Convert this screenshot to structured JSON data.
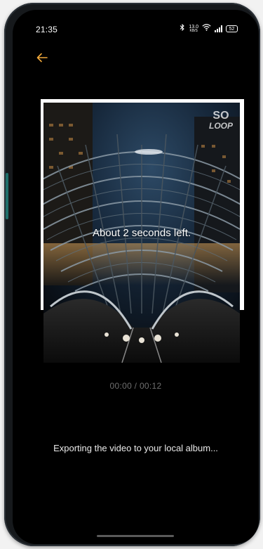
{
  "status_bar": {
    "time": "21:35",
    "bluetooth_icon": "bluetooth-icon",
    "network_speed_value": "13.0",
    "network_speed_unit": "KB/S",
    "wifi_icon": "wifi-icon",
    "signal_icon": "signal-icon",
    "battery_level": "52"
  },
  "toolbar": {
    "back_icon": "arrow-left-icon",
    "accent_color": "#f0a83a"
  },
  "preview": {
    "logo_line1": "SO",
    "logo_line2": "LOOP",
    "remaining_text": "About 2 seconds left."
  },
  "playback": {
    "timecode": "00:00 / 00:12"
  },
  "export": {
    "message": "Exporting the video to your local album..."
  }
}
